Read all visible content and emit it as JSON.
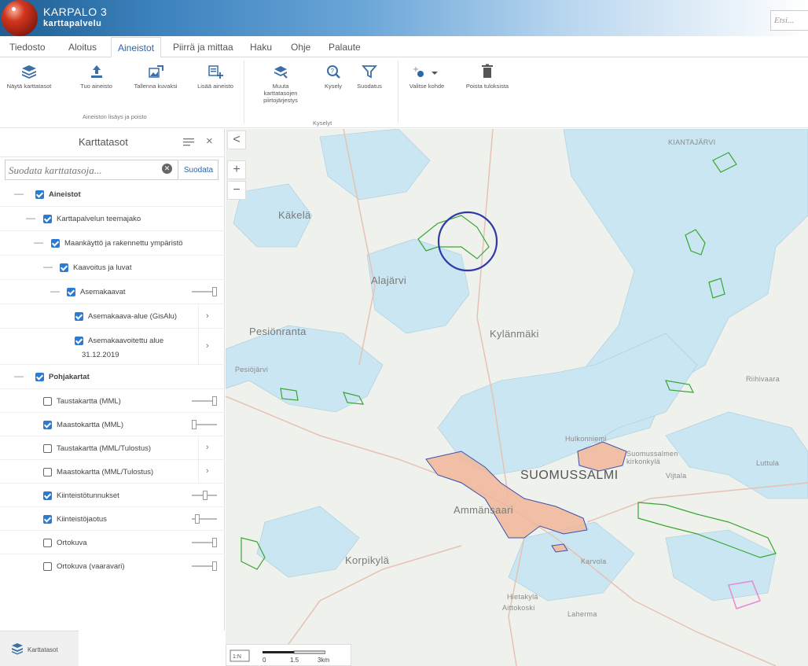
{
  "app": {
    "title": "KARPALO 3",
    "subtitle": "karttapalvelu",
    "search_placeholder": "Etsi..."
  },
  "menu": {
    "tabs": [
      {
        "label": "Tiedosto",
        "active": false
      },
      {
        "label": "Aloitus",
        "active": false
      },
      {
        "label": "Aineistot",
        "active": true
      },
      {
        "label": "Piirrä ja mittaa",
        "active": false
      },
      {
        "label": "Haku",
        "active": false
      },
      {
        "label": "Ohje",
        "active": false
      },
      {
        "label": "Palaute",
        "active": false
      }
    ]
  },
  "ribbon": {
    "group1": {
      "label": "Aineiston lisäys ja poisto",
      "buttons": [
        {
          "label": "Näytä karttatasot",
          "icon": "layers-icon"
        },
        {
          "label": "Tuo aineisto",
          "icon": "upload-icon"
        },
        {
          "label": "Tallenna kuvaksi",
          "icon": "save-image-icon"
        },
        {
          "label": "Lisää aineisto",
          "icon": "add-data-icon"
        }
      ]
    },
    "group2": {
      "label": "Kyselyt",
      "buttons": [
        {
          "label": "Muuta karttatasojen piirtojärjestys",
          "icon": "reorder-layers-icon"
        },
        {
          "label": "Kysely",
          "icon": "query-icon"
        },
        {
          "label": "Suodatus",
          "icon": "filter-icon"
        }
      ]
    },
    "group3": {
      "buttons": [
        {
          "label": "Valitse kohde",
          "icon": "select-feature-icon"
        },
        {
          "label": "Poista tuloksista",
          "icon": "trash-icon"
        }
      ]
    }
  },
  "sidebar": {
    "title": "Karttatasot",
    "filter_placeholder": "Suodata karttatasoja...",
    "filter_button": "Suodata",
    "footer_tab": "Karttatasot",
    "layers": [
      {
        "label": "Aineistot",
        "checked": true
      },
      {
        "label": "Karttapalvelun teemajako",
        "checked": true
      },
      {
        "label": "Maankäyttö ja rakennettu ympäristö",
        "checked": true
      },
      {
        "label": "Kaavoitus ja luvat",
        "checked": true
      },
      {
        "label": "Asemakaavat",
        "checked": true
      },
      {
        "label": "Asemakaava-alue (GisAlu)",
        "checked": true
      },
      {
        "label": "Asemakaavoitettu alue",
        "label2": "31.12.2019",
        "checked": true
      },
      {
        "label": "Pohjakartat",
        "checked": true
      },
      {
        "label": "Taustakartta (MML)",
        "checked": false,
        "opacity": 1.0
      },
      {
        "label": "Maastokartta (MML)",
        "checked": true,
        "opacity": 0.0
      },
      {
        "label": "Taustakartta (MML/Tulostus)",
        "checked": false
      },
      {
        "label": "Maastokartta (MML/Tulostus)",
        "checked": false
      },
      {
        "label": "Kiinteistötunnukset",
        "checked": true,
        "opacity": 0.5
      },
      {
        "label": "Kiinteistöjaotus",
        "checked": true,
        "opacity": 0.15
      },
      {
        "label": "Ortokuva",
        "checked": false,
        "opacity": 1.0
      },
      {
        "label": "Ortokuva (vaaravari)",
        "checked": false,
        "opacity": 1.0
      }
    ]
  },
  "map": {
    "controls": {
      "back": "<",
      "zoom_in": "+",
      "zoom_out": "−"
    },
    "labels": [
      {
        "text": "Käkelä"
      },
      {
        "text": "Alajärvi"
      },
      {
        "text": "Pesiönranta"
      },
      {
        "text": "Kylänmäki"
      },
      {
        "text": "SUOMUSSALMI"
      },
      {
        "text": "Ammänsaari"
      },
      {
        "text": "Hulkonniemi"
      },
      {
        "text": "Suomussalmen kirkonkylä"
      },
      {
        "text": "Vijtala"
      },
      {
        "text": "Luttula"
      },
      {
        "text": "Riihivaara"
      },
      {
        "text": "Korpikylä"
      },
      {
        "text": "Karvola"
      },
      {
        "text": "Hietakylä"
      },
      {
        "text": "Aittokoski"
      },
      {
        "text": "Laherma"
      },
      {
        "text": "KIANTAJÄRVI"
      },
      {
        "text": "Pesiöjärvi"
      }
    ],
    "scale": {
      "ticks": [
        "0",
        "1.5",
        "3km"
      ]
    },
    "colors": {
      "water": "#c9e6f2",
      "land": "#eef1ec",
      "zoning": "#f0a07c",
      "highlight_circle": "#2f3aa8"
    }
  }
}
